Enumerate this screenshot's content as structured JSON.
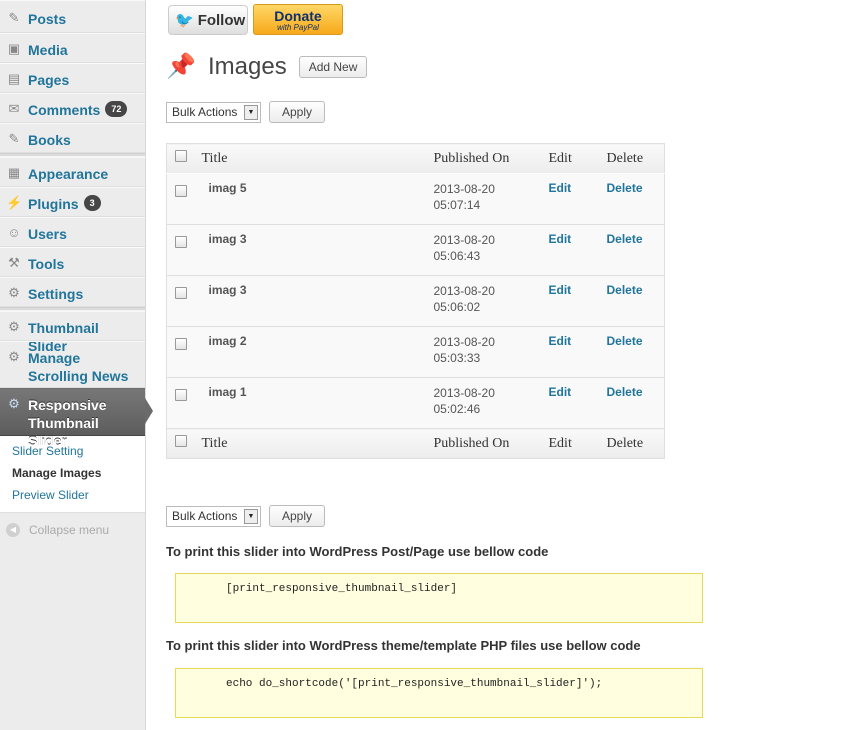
{
  "sidebar": {
    "items": [
      {
        "label": "Posts",
        "icon": "pushpin-icon",
        "glyph": "✎"
      },
      {
        "label": "Media",
        "icon": "media-icon",
        "glyph": "▣"
      },
      {
        "label": "Pages",
        "icon": "pages-icon",
        "glyph": "▤"
      },
      {
        "label": "Comments",
        "icon": "comments-icon",
        "glyph": "✉",
        "badge": "72"
      },
      {
        "label": "Books",
        "icon": "pushpin-icon",
        "glyph": "✎"
      },
      {
        "label": "Appearance",
        "icon": "appearance-icon",
        "glyph": "▦"
      },
      {
        "label": "Plugins",
        "icon": "plugins-icon",
        "glyph": "⚡",
        "badge": "3"
      },
      {
        "label": "Users",
        "icon": "users-icon",
        "glyph": "☺"
      },
      {
        "label": "Tools",
        "icon": "tools-icon",
        "glyph": "⚒"
      },
      {
        "label": "Settings",
        "icon": "settings-icon",
        "glyph": "⚙"
      },
      {
        "label": "Thumbnail Slider",
        "icon": "gear-icon",
        "glyph": "⚙"
      },
      {
        "label": "Manage Scrolling News",
        "icon": "gear-icon",
        "glyph": "⚙"
      },
      {
        "label": "Responsive Thumbnail Slider",
        "icon": "gear-icon",
        "glyph": "⚙"
      }
    ],
    "submenu": [
      "Slider Setting",
      "Manage Images",
      "Preview Slider"
    ],
    "collapse_label": "Collapse menu"
  },
  "header": {
    "follow_label": "Follow",
    "donate_label": "Donate",
    "donate_sub": "with PayPal",
    "title": "Images",
    "add_new_label": "Add New"
  },
  "bulk": {
    "select_value": "Bulk Actions",
    "apply_label": "Apply"
  },
  "table": {
    "columns": [
      "Title",
      "Published On",
      "Edit",
      "Delete"
    ],
    "rows": [
      {
        "title": "imag 5",
        "date": "2013-08-20",
        "time": "05:07:14",
        "edit": "Edit",
        "delete": "Delete"
      },
      {
        "title": "imag 3",
        "date": "2013-08-20",
        "time": "05:06:43",
        "edit": "Edit",
        "delete": "Delete"
      },
      {
        "title": "imag 3",
        "date": "2013-08-20",
        "time": "05:06:02",
        "edit": "Edit",
        "delete": "Delete"
      },
      {
        "title": "imag 2",
        "date": "2013-08-20",
        "time": "05:03:33",
        "edit": "Edit",
        "delete": "Delete"
      },
      {
        "title": "imag 1",
        "date": "2013-08-20",
        "time": "05:02:46",
        "edit": "Edit",
        "delete": "Delete"
      }
    ]
  },
  "notes": {
    "post_page": "To print this slider into WordPress Post/Page use bellow code",
    "post_page_code": "[print_responsive_thumbnail_slider]",
    "theme": "To print this slider into WordPress theme/template PHP files use bellow code",
    "theme_code": "echo do_shortcode('[print_responsive_thumbnail_slider]');"
  }
}
